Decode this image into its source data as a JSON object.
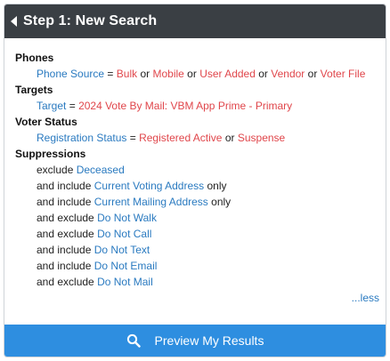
{
  "header": {
    "title": "Step 1: New Search"
  },
  "phones": {
    "title": "Phones",
    "key": "Phone Source",
    "eq": "=",
    "values": [
      "Bulk",
      "Mobile",
      "User Added",
      "Vendor",
      "Voter File"
    ],
    "or": "or"
  },
  "targets": {
    "title": "Targets",
    "key": "Target",
    "eq": "=",
    "value": "2024 Vote By Mail: VBM App Prime - Primary"
  },
  "voter_status": {
    "title": "Voter Status",
    "key": "Registration Status",
    "eq": "=",
    "values": [
      "Registered Active",
      "Suspense"
    ],
    "or": "or"
  },
  "suppressions": {
    "title": "Suppressions",
    "items": [
      {
        "prefix": "exclude",
        "link": "Deceased",
        "suffix": ""
      },
      {
        "prefix": "and include",
        "link": "Current Voting Address",
        "suffix": "only"
      },
      {
        "prefix": "and include",
        "link": "Current Mailing Address",
        "suffix": "only"
      },
      {
        "prefix": "and exclude",
        "link": "Do Not Walk",
        "suffix": ""
      },
      {
        "prefix": "and exclude",
        "link": "Do Not Call",
        "suffix": ""
      },
      {
        "prefix": "and include",
        "link": "Do Not Text",
        "suffix": ""
      },
      {
        "prefix": "and include",
        "link": "Do Not Email",
        "suffix": ""
      },
      {
        "prefix": "and exclude",
        "link": "Do Not Mail",
        "suffix": ""
      }
    ]
  },
  "less_link": "...less",
  "footer": {
    "button_label": "Preview My Results"
  },
  "icons": {
    "back": "chevron-left-icon",
    "search": "search-icon"
  }
}
